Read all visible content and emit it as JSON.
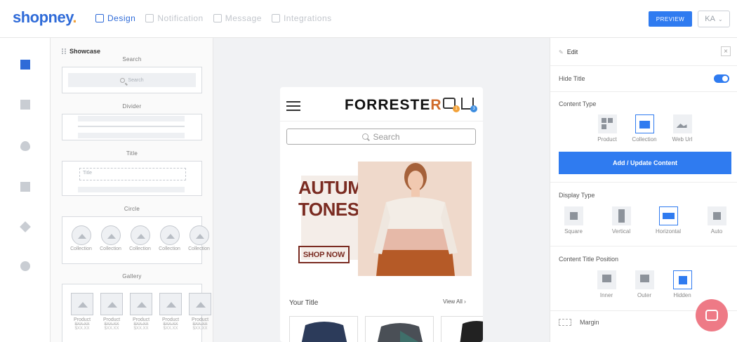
{
  "app": {
    "logo_text": "shopney",
    "logo_dot": ".",
    "brand_color": "#2f6bd8",
    "accent_color": "#2f7bf0"
  },
  "nav": {
    "tabs": [
      {
        "label": "Design",
        "icon": "design-icon",
        "active": true
      },
      {
        "label": "Notification",
        "icon": "notification-icon",
        "active": false
      },
      {
        "label": "Message",
        "icon": "message-icon",
        "active": false
      },
      {
        "label": "Integrations",
        "icon": "integrations-icon",
        "active": false
      }
    ],
    "preview_label": "PREVIEW",
    "user_initials": "KA"
  },
  "rail": {
    "icons": [
      "dashboard-icon",
      "page-icon",
      "drop-icon",
      "layout-icon",
      "box-icon",
      "settings-icon"
    ]
  },
  "showcase": {
    "title": "Showcase",
    "search_label": "Search",
    "search_placeholder": "Search",
    "divider_label": "Divider",
    "title_label": "Title",
    "title_placeholder": "Title",
    "circle_label": "Circle",
    "circle_items": [
      "Collection",
      "Collection",
      "Collection",
      "Collection",
      "Collection"
    ],
    "gallery_label": "Gallery",
    "gallery_items": [
      {
        "name": "Product",
        "old_price": "$XX.XX",
        "price": "$XX.XX"
      },
      {
        "name": "Product",
        "old_price": "$XX.XX",
        "price": "$XX.XX"
      },
      {
        "name": "Product",
        "old_price": "$XX.XX",
        "price": "$XX.XX"
      },
      {
        "name": "Product",
        "old_price": "$XX.XX",
        "price": "$XX.XX"
      },
      {
        "name": "Product",
        "old_price": "$XX.XX",
        "price": "$XX.XX"
      }
    ]
  },
  "preview": {
    "brand_main": "FORRESTE",
    "brand_last": "R",
    "chat_badge": "1",
    "cart_badge": "3",
    "search_placeholder": "Search",
    "banner_line1": "AUTUMN",
    "banner_line2": "TONES",
    "banner_button": "SHOP NOW",
    "section_title": "Your Title",
    "view_all": "View All"
  },
  "edit": {
    "header": "Edit",
    "hide_title_label": "Hide Title",
    "hide_title_on": true,
    "content_type_label": "Content Type",
    "content_types": [
      {
        "label": "Product",
        "selected": false
      },
      {
        "label": "Collection",
        "selected": true
      },
      {
        "label": "Web Url",
        "selected": false
      }
    ],
    "add_update_label": "Add / Update Content",
    "display_type_label": "Display Type",
    "display_types": [
      {
        "label": "Square",
        "selected": false
      },
      {
        "label": "Vertical",
        "selected": false
      },
      {
        "label": "Horizontal",
        "selected": true
      },
      {
        "label": "Auto",
        "selected": false
      }
    ],
    "title_position_label": "Content Title Position",
    "title_positions": [
      {
        "label": "Inner",
        "selected": false
      },
      {
        "label": "Outer",
        "selected": false
      },
      {
        "label": "Hidden",
        "selected": true
      }
    ],
    "margin_label": "Margin"
  }
}
